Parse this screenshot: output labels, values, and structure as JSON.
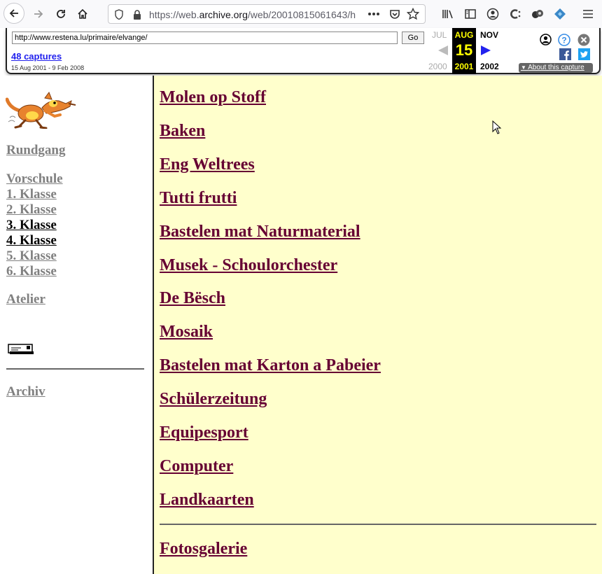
{
  "browser": {
    "url_prefix": "https://web.",
    "url_domain": "archive.org",
    "url_suffix": "/web/20010815061643/h"
  },
  "wayback": {
    "url_value": "http://www.restena.lu/primaire/elvange/",
    "go_label": "Go",
    "captures_label": "48 captures",
    "date_range": "15 Aug 2001 - 9 Feb 2008",
    "prev_month": "JUL",
    "current_month": "AUG",
    "next_month": "NOV",
    "current_day": "15",
    "prev_year": "2000",
    "current_year": "2001",
    "next_year": "2002",
    "about_label": "About this capture"
  },
  "sidebar": {
    "rundgang": "Rundgang",
    "vorschule": "Vorschule",
    "klasse1": "1. Klasse",
    "klasse2": "2. Klasse",
    "klasse3": "3. Klasse",
    "klasse4": "4. Klasse",
    "klasse5": "5. Klasse",
    "klasse6": "6. Klasse",
    "atelier": "Atelier",
    "archiv": "Archiv"
  },
  "main": {
    "links": [
      "Molen op Stoff",
      "Baken",
      "Eng Weltrees",
      "Tutti frutti",
      "Bastelen mat Naturmaterial",
      "Musek - Schoulorchester",
      "De Bësch",
      "Mosaik",
      "Bastelen mat Karton a Pabeier",
      "Schülerzeitung",
      "Equipesport",
      "Computer",
      "Landkaarten"
    ],
    "fotos": "Fotosgalerie"
  },
  "colors": {
    "main_bg": "#ffffcc",
    "main_link": "#660033",
    "side_link": "#808080"
  }
}
